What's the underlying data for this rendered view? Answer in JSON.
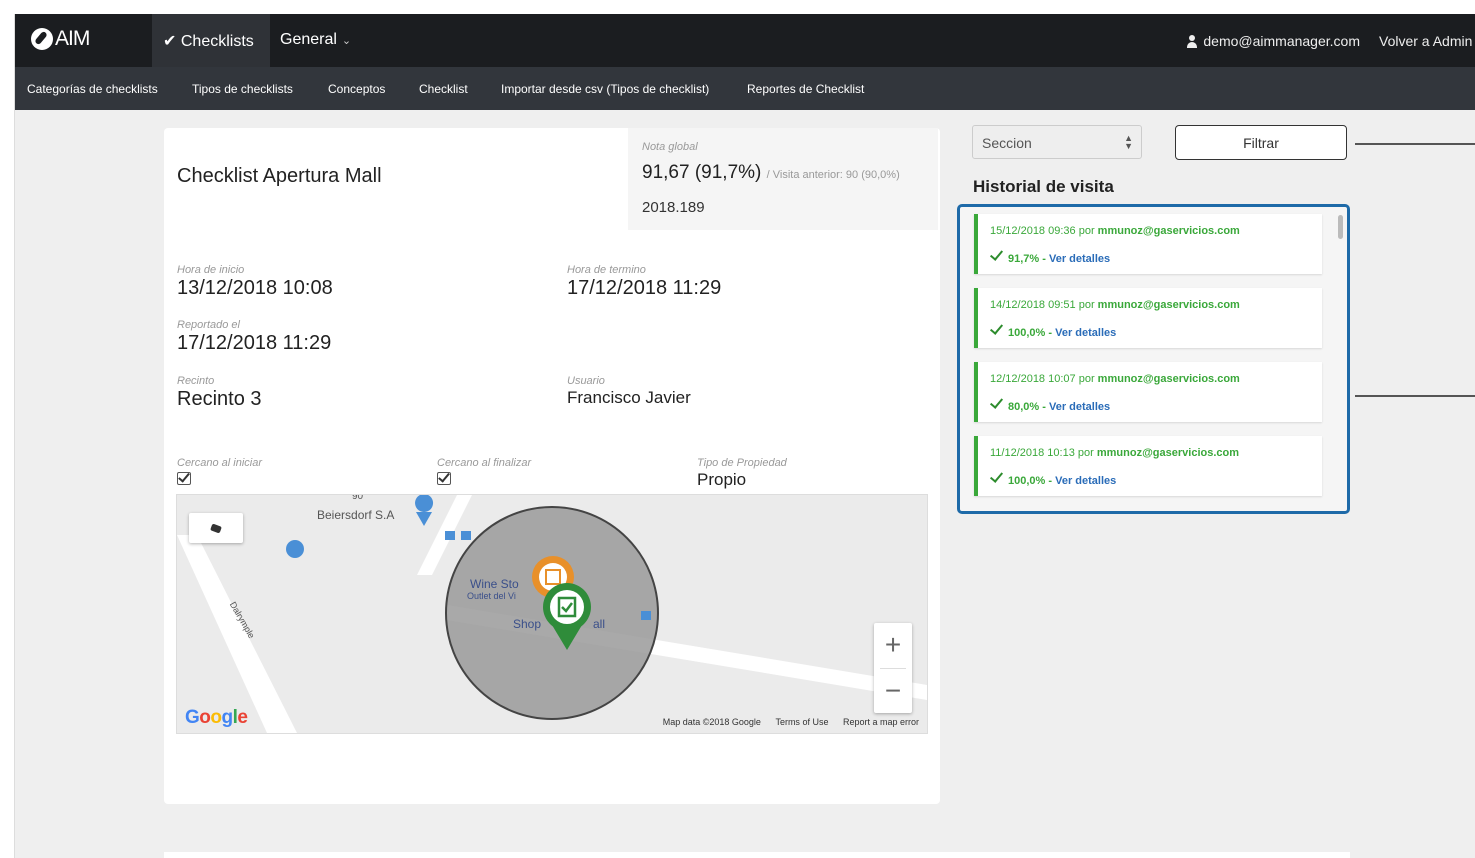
{
  "app": {
    "logo": "AIM"
  },
  "topnav": {
    "checklists": "Checklists",
    "general": "General",
    "user_email": "demo@aimmanager.com",
    "volver": "Volver a Admin"
  },
  "subnav": [
    "Categorías de checklists",
    "Tipos de checklists",
    "Conceptos",
    "Checklist",
    "Importar desde csv (Tipos de checklist)",
    "Reportes de Checklist"
  ],
  "checklist": {
    "title": "Checklist Apertura Mall",
    "nota_label": "Nota global",
    "nota_value": "91,67 (91,7%)",
    "nota_prev": "/ Visita anterior: 90 (90,0%)",
    "code": "2018.189",
    "hora_inicio_label": "Hora de inicio",
    "hora_inicio": "13/12/2018 10:08",
    "hora_termino_label": "Hora de termino",
    "hora_termino": "17/12/2018 11:29",
    "reportado_label": "Reportado el",
    "reportado": "17/12/2018 11:29",
    "recinto_label": "Recinto",
    "recinto": "Recinto 3",
    "usuario_label": "Usuario",
    "usuario": "Francisco Javier",
    "cercano_iniciar_label": "Cercano al iniciar",
    "cercano_iniciar": true,
    "cercano_finalizar_label": "Cercano al finalizar",
    "cercano_finalizar": true,
    "tipo_propiedad_label": "Tipo de Propiedad",
    "tipo_propiedad": "Propio"
  },
  "map": {
    "poi_1": "Beiersdorf S.A",
    "poi_2": "Wine Sto",
    "poi_2b": "Outlet del Vi",
    "poi_3": "Shop",
    "poi_3b": "all",
    "poi_top": "90",
    "street": "Dalrymple",
    "attribution": "Map data ©2018 Google",
    "terms": "Terms of Use",
    "report": "Report a map error",
    "google": "Google",
    "zoom_in": "+",
    "zoom_out": "−"
  },
  "filter": {
    "section_select": "Seccion",
    "filter_button": "Filtrar"
  },
  "history": {
    "title": "Historial de visita",
    "por": "por",
    "ver_detalles": "Ver detalles",
    "items": [
      {
        "date": "15/12/2018 09:36",
        "user": "mmunoz@gaservicios.com",
        "score": "91,7%"
      },
      {
        "date": "14/12/2018 09:51",
        "user": "mmunoz@gaservicios.com",
        "score": "100,0%"
      },
      {
        "date": "12/12/2018 10:07",
        "user": "mmunoz@gaservicios.com",
        "score": "80,0%"
      },
      {
        "date": "11/12/2018 10:13",
        "user": "mmunoz@gaservicios.com",
        "score": "100,0%"
      }
    ]
  },
  "colors": {
    "accent_green": "#3aa83a",
    "border_blue": "#1e6aa8",
    "topbar": "#1b1d20"
  }
}
